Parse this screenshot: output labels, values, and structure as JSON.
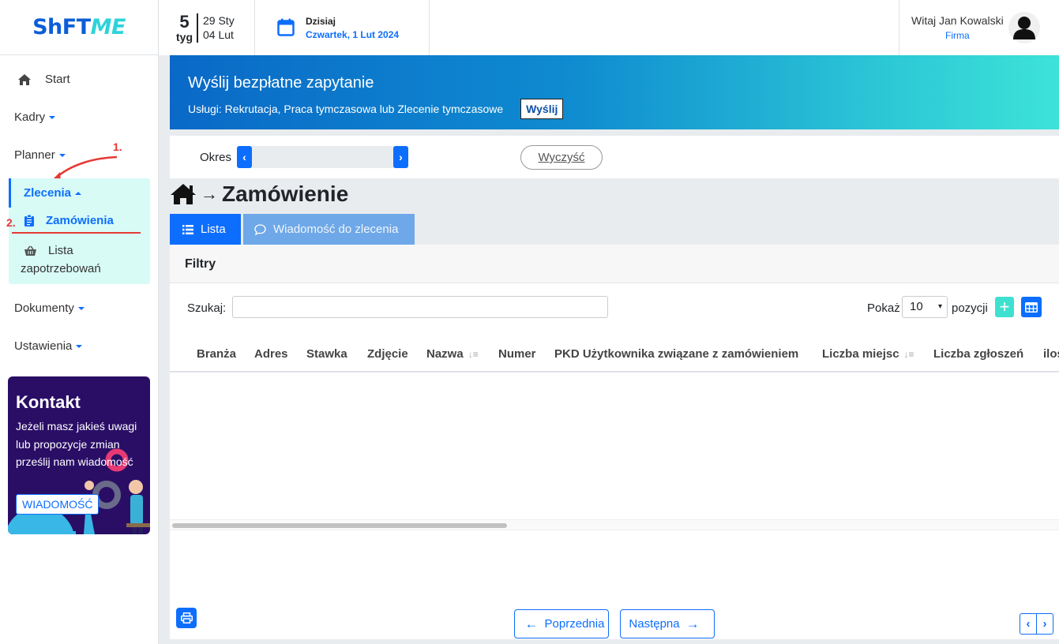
{
  "header": {
    "logo_main": "ShFT",
    "logo_accent": "ME",
    "week_number": "5",
    "week_label": "tyg",
    "week_start": "29 Sty",
    "week_end": "04 Lut",
    "today_label": "Dzisiaj",
    "today_date": "Czwartek, 1 Lut 2024",
    "greeting": "Witaj Jan Kowalski",
    "company": "Firma"
  },
  "sidebar": {
    "start": "Start",
    "kadry": "Kadry",
    "planner": "Planner",
    "zlecenia": "Zlecenia",
    "zamowienia": "Zamówienia",
    "lista_line1": "Lista",
    "lista_line2": "zapotrzebowań",
    "dokumenty": "Dokumenty",
    "ustawienia": "Ustawienia",
    "annotation_1": "1.",
    "annotation_2": "2."
  },
  "contact": {
    "title": "Kontakt",
    "text": "Jeżeli masz jakieś uwagi lub propozycje zmian prześlij nam wiadomość",
    "button": "WIADOMOŚĆ"
  },
  "banner": {
    "title": "Wyślij bezpłatne zapytanie",
    "subtitle": "Usługi: Rekrutacja, Praca tymczasowa lub Zlecenie tymczasowe",
    "button": "Wyślij"
  },
  "period": {
    "label": "Okres",
    "clear": "Wyczyść"
  },
  "page": {
    "title": "Zamówienie",
    "tab_list": "Lista",
    "tab_message": "Wiadomość do zlecenia"
  },
  "filters": {
    "heading": "Filtry",
    "search_label": "Szukaj:",
    "search_value": "",
    "show_label": "Pokaż",
    "show_value": "10",
    "items_label": "pozycji"
  },
  "table": {
    "columns": [
      "Branża",
      "Adres",
      "Stawka",
      "Zdjęcie",
      "Nazwa",
      "Numer",
      "PKD Użytkownika związane z zamówieniem",
      "Liczba miejsc",
      "Liczba zgłoszeń",
      "ilość"
    ]
  },
  "pagination": {
    "prev": "Poprzednia",
    "next": "Następna"
  },
  "colors": {
    "primary": "#0d6efd",
    "accent": "#3ee1cf",
    "annotation": "#e53935",
    "contact_bg": "#2a0e66"
  },
  "icons": [
    "home-icon",
    "calendar-icon",
    "user-avatar-icon",
    "clipboard-icon",
    "basket-icon",
    "list-icon",
    "chat-icon",
    "plus-icon",
    "table-icon",
    "print-icon",
    "sort-icon"
  ]
}
